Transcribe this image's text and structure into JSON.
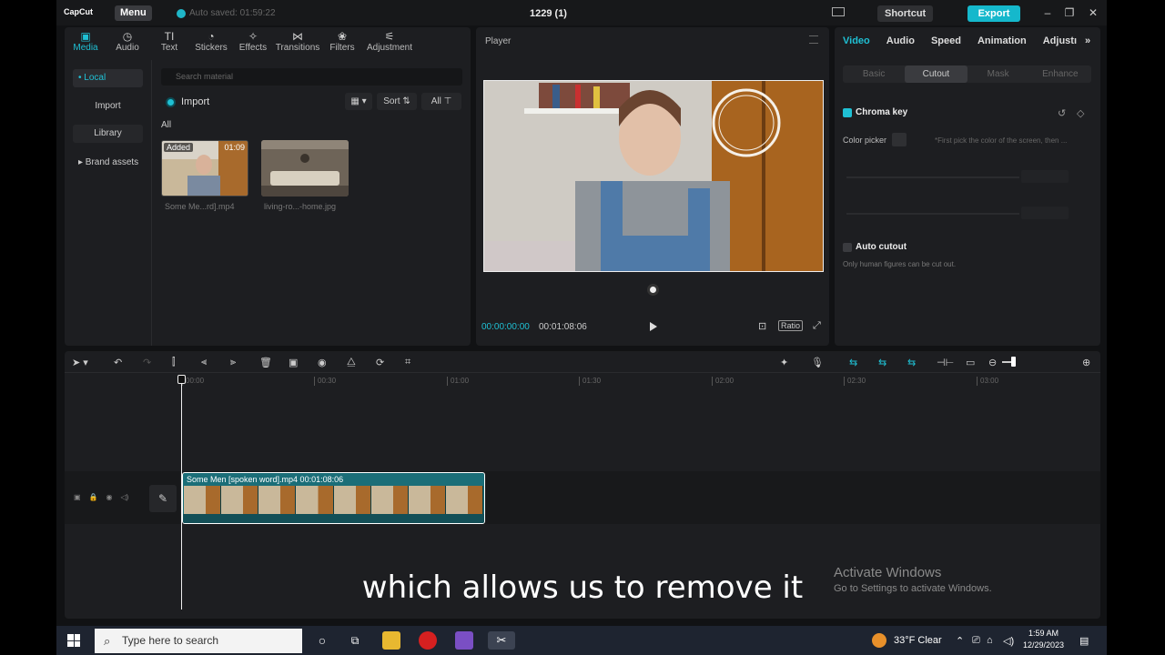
{
  "titlebar": {
    "logo": "CapCut",
    "menu_label": "Menu",
    "autosave": "Auto saved: 01:59:22",
    "project_title": "1229 (1)",
    "shortcut_label": "Shortcut",
    "export_label": "Export",
    "minimize": "–",
    "maximize": "❐",
    "close": "✕"
  },
  "media": {
    "tabs": [
      {
        "label": "Media",
        "icon": "▣"
      },
      {
        "label": "Audio",
        "icon": "◷"
      },
      {
        "label": "Text",
        "icon": "TI"
      },
      {
        "label": "Stickers",
        "icon": "◔"
      },
      {
        "label": "Effects",
        "icon": "✧"
      },
      {
        "label": "Transitions",
        "icon": "⋈"
      },
      {
        "label": "Filters",
        "icon": "❀"
      },
      {
        "label": "Adjustment",
        "icon": "⚟"
      }
    ],
    "sidebar": {
      "local": "• Local",
      "import": "Import",
      "library": "Library",
      "brand_assets": "▸ Brand assets"
    },
    "search_placeholder": "Search material",
    "import_label": "Import",
    "sort_label": "Sort",
    "all_filter": "All",
    "section_all": "All",
    "items": [
      {
        "caption": "Some Me...rd].mp4",
        "badge": "Added",
        "duration": "01:09"
      },
      {
        "caption": "living-ro...-home.jpg"
      }
    ]
  },
  "player": {
    "title": "Player",
    "time_current": "00:00:00:00",
    "time_total": "00:01:08:06",
    "ratio_label": "Ratio"
  },
  "props": {
    "tabs": [
      "Video",
      "Audio",
      "Speed",
      "Animation",
      "Adjustı"
    ],
    "more": "»",
    "subtabs": [
      "Basic",
      "Cutout",
      "Mask",
      "Enhance"
    ],
    "chroma_key": "Chroma key",
    "color_picker": "Color picker",
    "picker_hint": "*First pick the color of the screen, then ...",
    "auto_cutout": "Auto cutout",
    "auto_cutout_desc": "Only human figures can be cut out."
  },
  "timeline": {
    "ruler": [
      "00:00",
      "00:30",
      "01:00",
      "01:30",
      "02:00",
      "02:30",
      "03:00"
    ],
    "clip_label": "Some Men [spoken word].mp4   00:01:08:06"
  },
  "overlay": {
    "subtitle": "which allows us to remove it",
    "activate_title": "Activate Windows",
    "activate_sub": "Go to Settings to activate Windows."
  },
  "taskbar": {
    "search_placeholder": "Type here to search",
    "weather": "33°F  Clear",
    "time": "1:59 AM",
    "date": "12/29/2023"
  },
  "colors": {
    "accent": "#1fc0d4",
    "export": "#15b8cc",
    "clip": "#1b6e78"
  }
}
